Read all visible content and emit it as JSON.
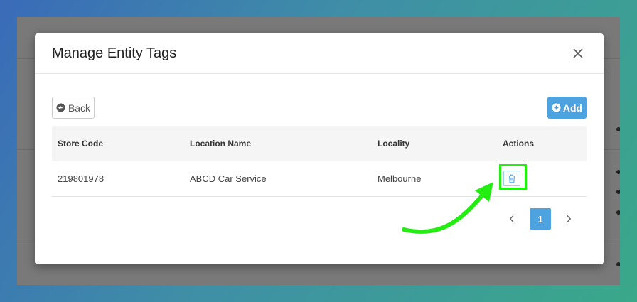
{
  "modal": {
    "title": "Manage Entity Tags",
    "close_icon": "close-icon"
  },
  "toolbar": {
    "back_label": "Back",
    "add_label": "Add"
  },
  "table": {
    "headers": [
      "Store Code",
      "Location Name",
      "Locality",
      "Actions"
    ],
    "rows": [
      {
        "store_code": "219801978",
        "location_name": "ABCD Car Service",
        "locality": "Melbourne",
        "action_icon": "trash-icon"
      }
    ]
  },
  "pagination": {
    "current_page": "1"
  },
  "colors": {
    "accent": "#4da3df",
    "highlight": "#22ee11"
  }
}
